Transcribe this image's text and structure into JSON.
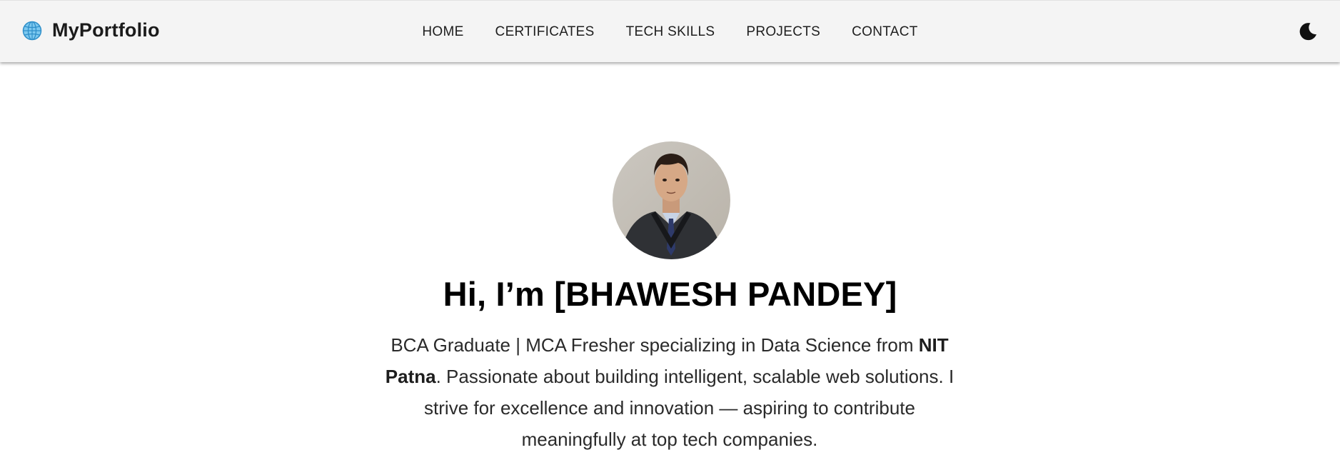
{
  "brand": {
    "name": "MyPortfolio",
    "icon": "globe-icon",
    "icon_color": "#3fa9e0"
  },
  "nav": {
    "items": [
      {
        "label": "HOME"
      },
      {
        "label": "CERTIFICATES"
      },
      {
        "label": "TECH SKILLS"
      },
      {
        "label": "PROJECTS"
      },
      {
        "label": "CONTACT"
      }
    ],
    "theme_toggle_icon": "moon-icon"
  },
  "hero": {
    "avatar_icon": "profile-photo",
    "title": "Hi, I’m [BHAWESH PANDEY]",
    "desc_part1": "BCA Graduate | MCA Fresher specializing in Data Science from ",
    "desc_bold": "NIT Patna",
    "desc_part2": ". Passionate about building intelligent, scalable web solutions. I strive for excellence and innovation — aspiring to contribute meaningfully at top tech companies."
  },
  "colors": {
    "navbar_bg": "#f4f4f4",
    "page_bg": "#ffffff",
    "text": "#222222"
  }
}
